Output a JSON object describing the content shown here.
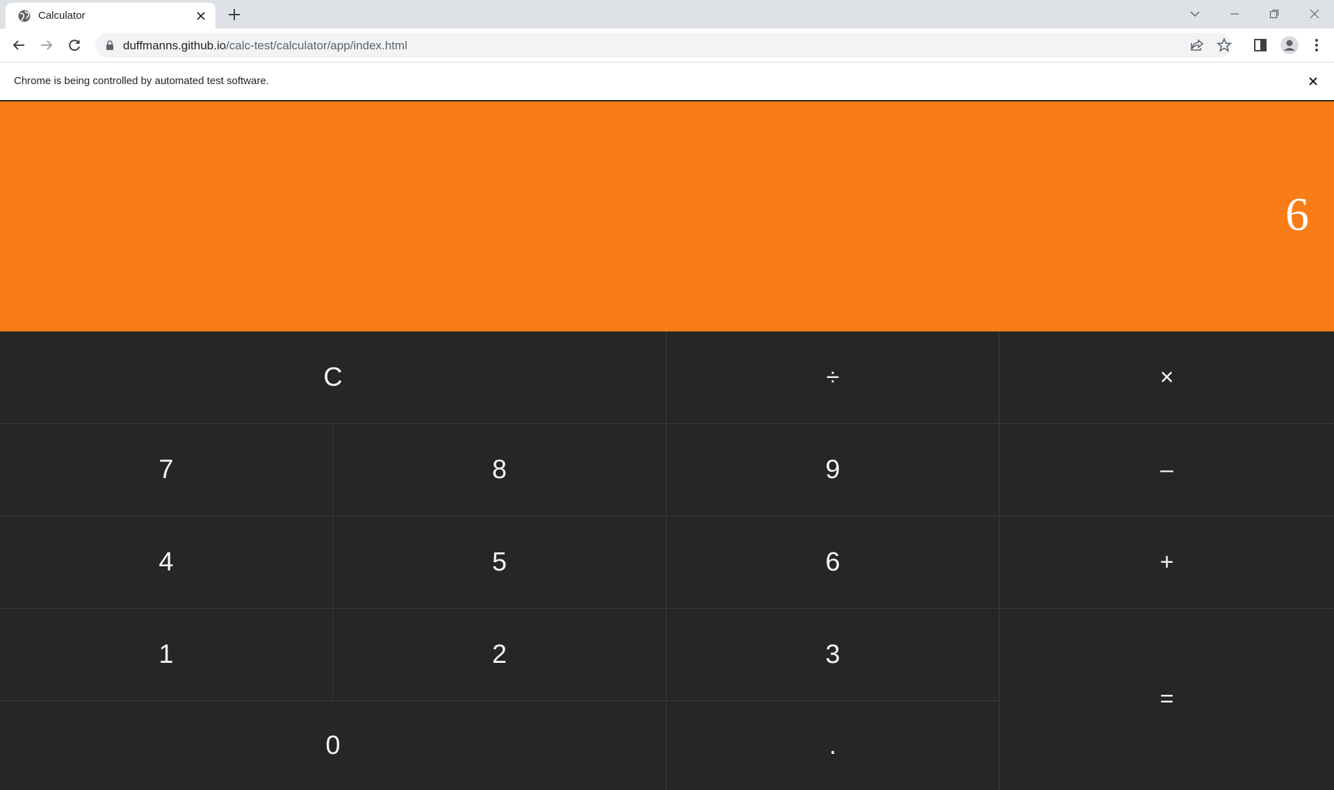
{
  "browser": {
    "tab_title": "Calculator",
    "url_host": "duffmanns.github.io",
    "url_path": "/calc-test/calculator/app/index.html",
    "infobar_message": "Chrome is being controlled by automated test software."
  },
  "calculator": {
    "display_value": "6",
    "display_color": "#f97d17",
    "keys": {
      "clear": "C",
      "divide": "÷",
      "multiply": "×",
      "seven": "7",
      "eight": "8",
      "nine": "9",
      "minus": "–",
      "four": "4",
      "five": "5",
      "six": "6",
      "plus": "+",
      "one": "1",
      "two": "2",
      "three": "3",
      "equals": "=",
      "zero": "0",
      "decimal": "."
    }
  }
}
